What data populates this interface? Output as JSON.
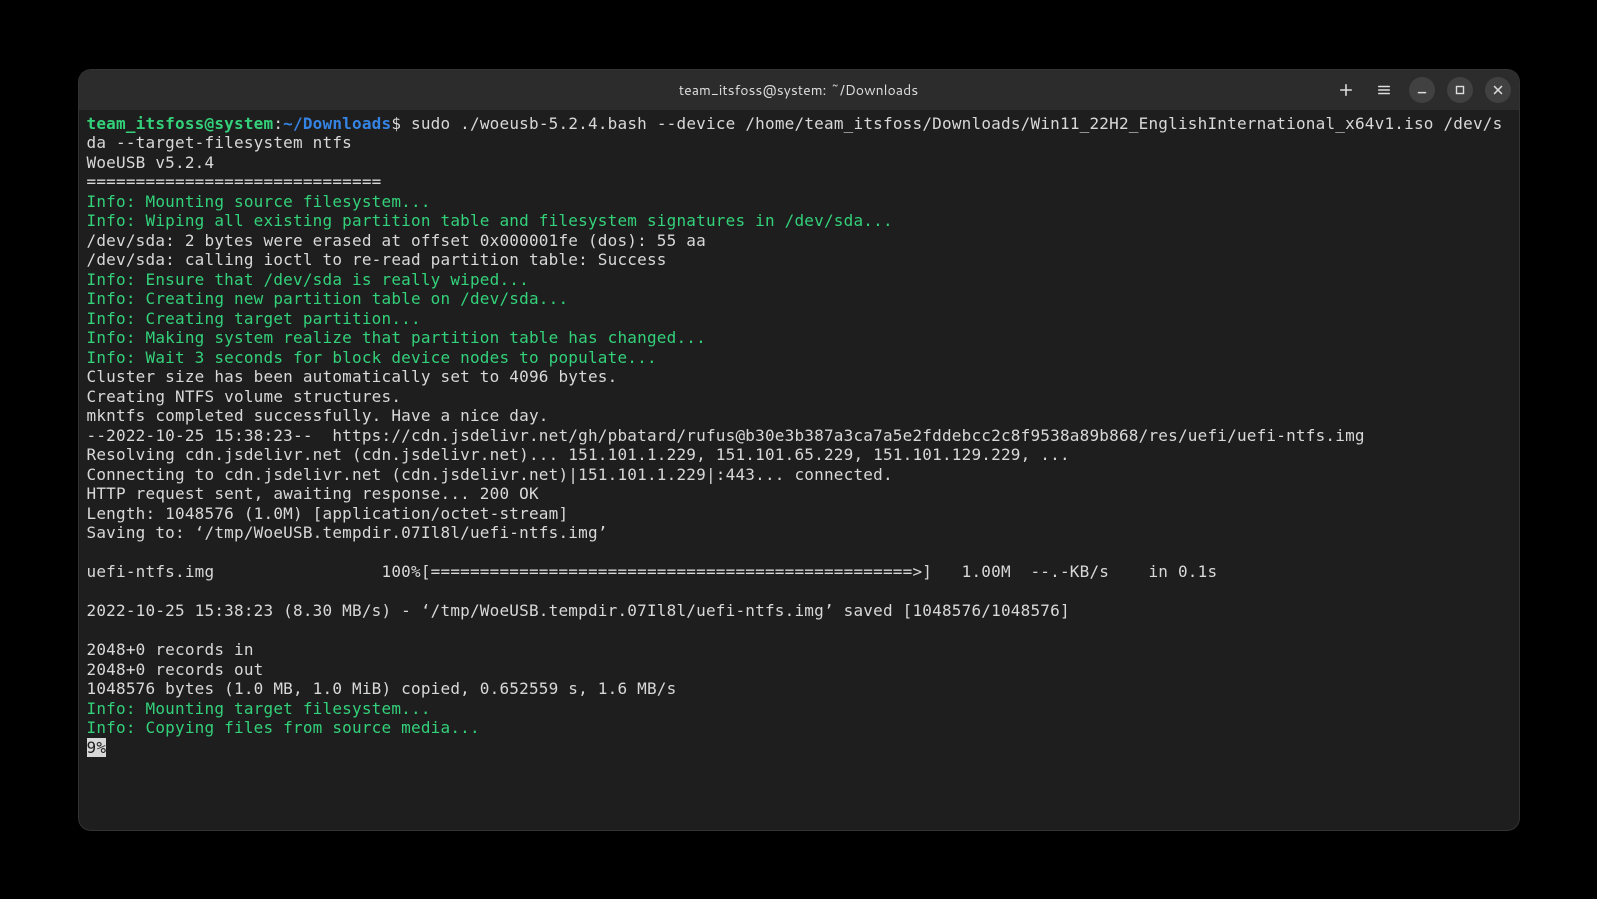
{
  "titlebar": {
    "title": "team_itsfoss@system: ~/Downloads"
  },
  "prompt": {
    "userhost": "team_itsfoss@system",
    "sep1": ":",
    "path": "~/Downloads",
    "sigil": "$ ",
    "command": "sudo ./woeusb-5.2.4.bash --device /home/team_itsfoss/Downloads/Win11_22H2_EnglishInternational_x64v1.iso /dev/sda --target-filesystem ntfs"
  },
  "lines": {
    "l01": "WoeUSB v5.2.4",
    "l02": "==============================",
    "l03": "Info: Mounting source filesystem...",
    "l04": "Info: Wiping all existing partition table and filesystem signatures in /dev/sda...",
    "l05": "/dev/sda: 2 bytes were erased at offset 0x000001fe (dos): 55 aa",
    "l06": "/dev/sda: calling ioctl to re-read partition table: Success",
    "l07": "Info: Ensure that /dev/sda is really wiped...",
    "l08": "Info: Creating new partition table on /dev/sda...",
    "l09": "Info: Creating target partition...",
    "l10": "Info: Making system realize that partition table has changed...",
    "l11": "Info: Wait 3 seconds for block device nodes to populate...",
    "l12": "Cluster size has been automatically set to 4096 bytes.",
    "l13": "Creating NTFS volume structures.",
    "l14": "mkntfs completed successfully. Have a nice day.",
    "l15": "--2022-10-25 15:38:23--  https://cdn.jsdelivr.net/gh/pbatard/rufus@b30e3b387a3ca7a5e2fddebcc2c8f9538a89b868/res/uefi/uefi-ntfs.img",
    "l16": "Resolving cdn.jsdelivr.net (cdn.jsdelivr.net)... 151.101.1.229, 151.101.65.229, 151.101.129.229, ...",
    "l17": "Connecting to cdn.jsdelivr.net (cdn.jsdelivr.net)|151.101.1.229|:443... connected.",
    "l18": "HTTP request sent, awaiting response... 200 OK",
    "l19": "Length: 1048576 (1.0M) [application/octet-stream]",
    "l20": "Saving to: ‘/tmp/WoeUSB.tempdir.07Il8l/uefi-ntfs.img’",
    "l21": "",
    "l22": "uefi-ntfs.img                 100%[=================================================>]   1.00M  --.-KB/s    in 0.1s",
    "l23": "",
    "l24": "2022-10-25 15:38:23 (8.30 MB/s) - ‘/tmp/WoeUSB.tempdir.07Il8l/uefi-ntfs.img’ saved [1048576/1048576]",
    "l25": "",
    "l26": "2048+0 records in",
    "l27": "2048+0 records out",
    "l28": "1048576 bytes (1.0 MB, 1.0 MiB) copied, 0.652559 s, 1.6 MB/s",
    "l29": "Info: Mounting target filesystem...",
    "l30": "Info: Copying files from source media...",
    "progress": "9%"
  }
}
